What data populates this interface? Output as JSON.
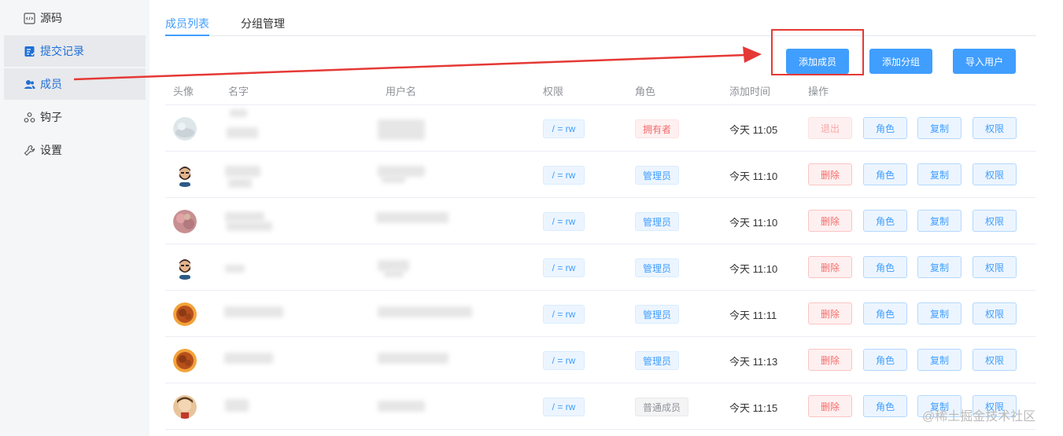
{
  "sidebar": {
    "items": [
      {
        "label": "源码",
        "icon": "code-file-icon"
      },
      {
        "label": "提交记录",
        "icon": "commit-log-icon"
      },
      {
        "label": "成员",
        "icon": "user-icon"
      },
      {
        "label": "钩子",
        "icon": "webhook-icon"
      },
      {
        "label": "设置",
        "icon": "wrench-icon"
      }
    ]
  },
  "tabs": [
    {
      "label": "成员列表",
      "active": true
    },
    {
      "label": "分组管理",
      "active": false
    }
  ],
  "toolbar": {
    "add_member": "添加成员",
    "add_group": "添加分组",
    "import_users": "导入用户"
  },
  "table": {
    "headers": [
      "头像",
      "名字",
      "用户名",
      "权限",
      "角色",
      "添加时间",
      "操作"
    ],
    "rows": [
      {
        "perm": "/ = rw",
        "role": "拥有者",
        "role_type": "owner",
        "time": "今天 11:05",
        "op1": "退出",
        "op1_disabled": true,
        "op2": "角色",
        "op3": "复制",
        "op4": "权限",
        "avatar": "cloud"
      },
      {
        "perm": "/ = rw",
        "role": "管理员",
        "role_type": "admin",
        "time": "今天 11:10",
        "op1": "删除",
        "op1_disabled": false,
        "op2": "角色",
        "op3": "复制",
        "op4": "权限",
        "avatar": "beard"
      },
      {
        "perm": "/ = rw",
        "role": "管理员",
        "role_type": "admin",
        "time": "今天 11:10",
        "op1": "删除",
        "op1_disabled": false,
        "op2": "角色",
        "op3": "复制",
        "op4": "权限",
        "avatar": "flower"
      },
      {
        "perm": "/ = rw",
        "role": "管理员",
        "role_type": "admin",
        "time": "今天 11:10",
        "op1": "删除",
        "op1_disabled": false,
        "op2": "角色",
        "op3": "复制",
        "op4": "权限",
        "avatar": "beard"
      },
      {
        "perm": "/ = rw",
        "role": "管理员",
        "role_type": "admin",
        "time": "今天 11:11",
        "op1": "删除",
        "op1_disabled": false,
        "op2": "角色",
        "op3": "复制",
        "op4": "权限",
        "avatar": "orange"
      },
      {
        "perm": "/ = rw",
        "role": "管理员",
        "role_type": "admin",
        "time": "今天 11:13",
        "op1": "删除",
        "op1_disabled": false,
        "op2": "角色",
        "op3": "复制",
        "op4": "权限",
        "avatar": "orange"
      },
      {
        "perm": "/ = rw",
        "role": "普通成员",
        "role_type": "member",
        "time": "今天 11:15",
        "op1": "删除",
        "op1_disabled": false,
        "op2": "角色",
        "op3": "复制",
        "op4": "权限",
        "avatar": "cartoon"
      }
    ]
  },
  "watermark": "@稀土掘金技术社区",
  "colors": {
    "primary": "#409eff",
    "danger": "#f56c6c",
    "annotation": "#e53935"
  }
}
